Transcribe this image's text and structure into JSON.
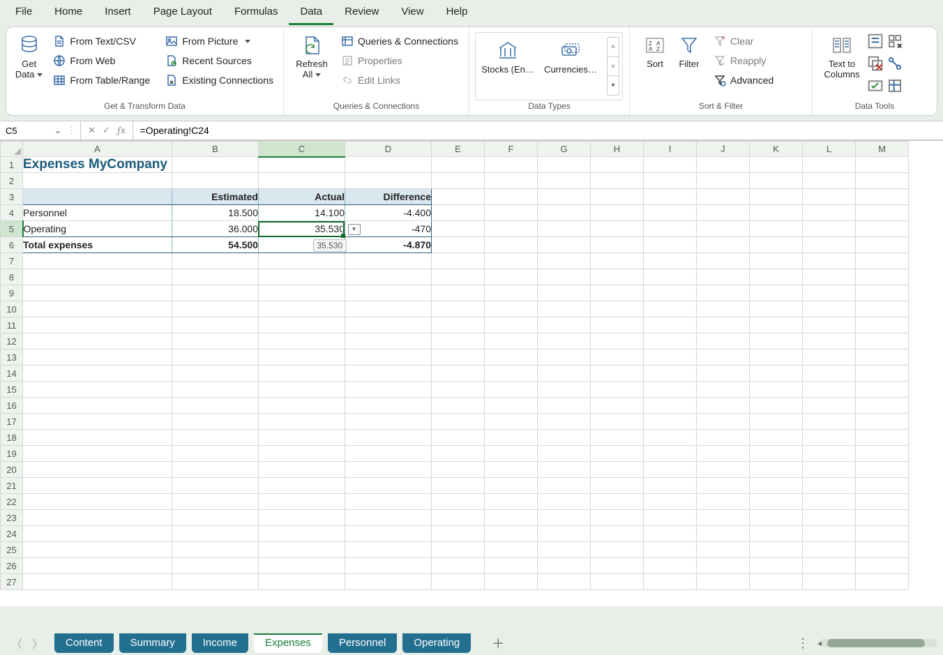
{
  "menu": {
    "tabs": [
      "File",
      "Home",
      "Insert",
      "Page Layout",
      "Formulas",
      "Data",
      "Review",
      "View",
      "Help"
    ],
    "active": 5
  },
  "ribbon": {
    "groups": {
      "get_transform": {
        "label": "Get & Transform Data",
        "get_data": "Get\nData",
        "from_text_csv": "From Text/CSV",
        "from_web": "From Web",
        "from_table_range": "From Table/Range",
        "from_picture": "From Picture",
        "recent_sources": "Recent Sources",
        "existing_connections": "Existing Connections"
      },
      "queries": {
        "label": "Queries & Connections",
        "refresh_all": "Refresh\nAll",
        "queries_connections": "Queries & Connections",
        "properties": "Properties",
        "edit_links": "Edit Links"
      },
      "data_types": {
        "label": "Data Types",
        "stocks": "Stocks (En…",
        "currencies": "Currencies…"
      },
      "sort_filter": {
        "label": "Sort & Filter",
        "sort": "Sort",
        "filter": "Filter",
        "clear": "Clear",
        "reapply": "Reapply",
        "advanced": "Advanced"
      },
      "data_tools": {
        "label": "Data Tools",
        "text_to_columns": "Text to\nColumns"
      }
    }
  },
  "namebox": {
    "value": "C5"
  },
  "formula": {
    "value": "=Operating!C24"
  },
  "columns": [
    "A",
    "B",
    "C",
    "D",
    "E",
    "F",
    "G",
    "H",
    "I",
    "J",
    "K",
    "L",
    "M"
  ],
  "rows": 27,
  "selected": {
    "col": "C",
    "row": 5
  },
  "spreadsheet": {
    "title": "Expenses MyCompany",
    "headers": {
      "b": "Estimated",
      "c": "Actual",
      "d": "Difference"
    },
    "r4": {
      "a": "Personnel",
      "b": "18.500",
      "c": "14.100",
      "d": "-4.400"
    },
    "r5": {
      "a": "Operating",
      "b": "36.000",
      "c": "35.530",
      "d": "-470"
    },
    "r6": {
      "a": "Total expenses",
      "b": "54.500",
      "c": "35.530",
      "d": "-4.870"
    }
  },
  "sheet_tabs": {
    "list": [
      "Content",
      "Summary",
      "Income",
      "Expenses",
      "Personnel",
      "Operating"
    ],
    "active": 3
  }
}
